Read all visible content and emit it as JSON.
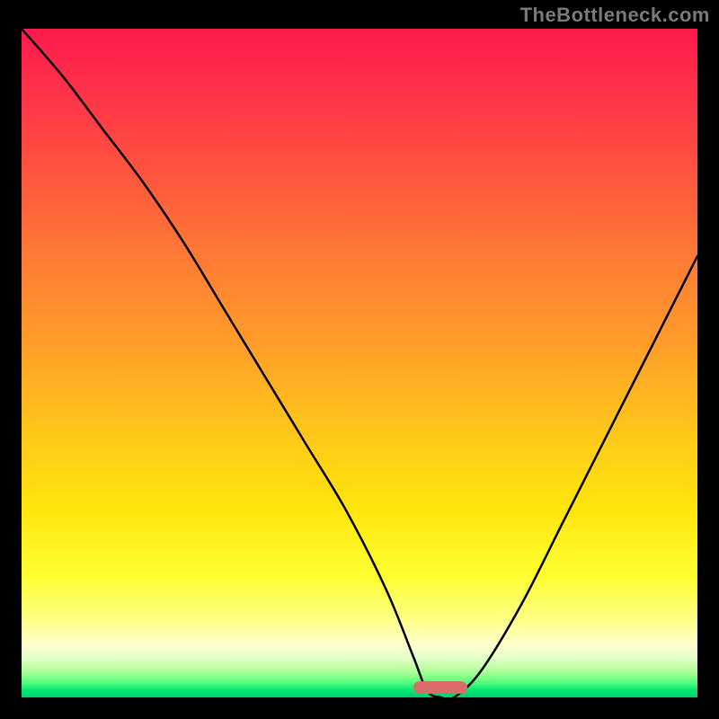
{
  "watermark": "TheBottleneck.com",
  "colors": {
    "background": "#000000",
    "curve": "#000000",
    "marker": "#d96b6b"
  },
  "chart_data": {
    "type": "line",
    "title": "",
    "xlabel": "",
    "ylabel": "",
    "xlim": [
      0,
      100
    ],
    "ylim": [
      0,
      100
    ],
    "grid": false,
    "legend": false,
    "annotations": [],
    "series": [
      {
        "name": "bottleneck-curve",
        "x": [
          0,
          6,
          12,
          18,
          24,
          30,
          36,
          42,
          48,
          54,
          58,
          60,
          62,
          64,
          68,
          74,
          80,
          86,
          92,
          100
        ],
        "values": [
          100,
          93,
          85,
          77,
          68,
          58,
          48,
          38,
          28,
          16,
          6,
          1,
          0,
          0,
          4,
          14,
          26,
          38,
          50,
          66
        ]
      }
    ],
    "marker": {
      "x_start": 58,
      "x_end": 66,
      "y": 0
    }
  }
}
